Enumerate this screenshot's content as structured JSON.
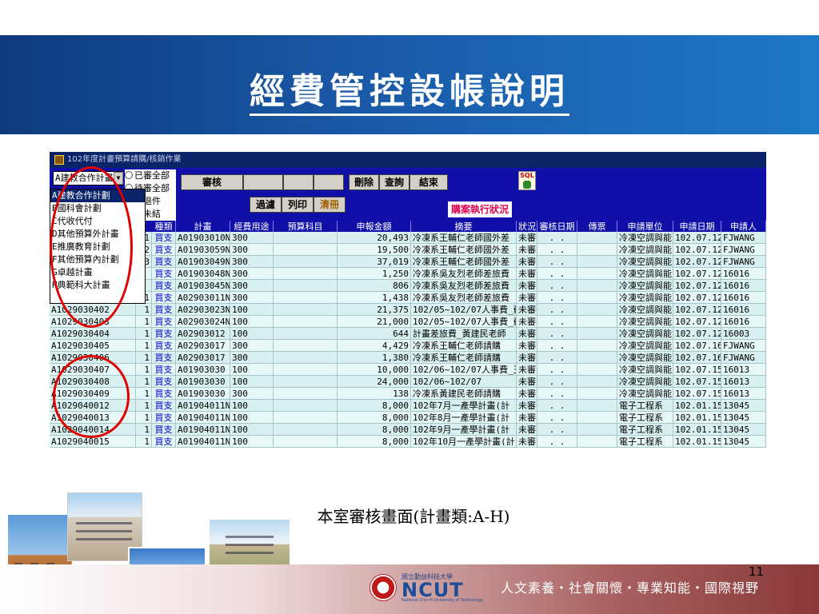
{
  "slide": {
    "title": "經費管控設帳說明",
    "caption": "本室審核畫面(計畫類:A-H)",
    "page_number": "11",
    "motto": "人文素養‧社會關懷‧專業知能‧國際視野",
    "logo": {
      "small_text": "國立勤益科技大學",
      "main_text": "NCUT",
      "sub_text": "National Chin-Yi University of Technology"
    }
  },
  "app": {
    "window_title": "102年度計畫預算請購/核銷作業",
    "plan_select_value": "A建教合作計畫",
    "radio_options": [
      "已審全部",
      "待審全部",
      "審退件",
      "審未結"
    ],
    "buttons": {
      "review": "審核",
      "delete": "刪除",
      "query": "查詢",
      "end": "結束",
      "filter": "過濾",
      "print": "列印",
      "clear": "清冊"
    },
    "sql_label": "SQL",
    "execution_status": "購案執行狀況",
    "dropdown_items": [
      "A建教合作計劃",
      "B國科會計劃",
      "C代收代付",
      "D其他預算外計畫",
      "E推廣教育計劃",
      "F其他預算內計劃",
      "G卓越計畫",
      "H典範科大計畫"
    ],
    "columns": [
      "序",
      "種類",
      "計畫",
      "經費用途",
      "預算科目",
      "申報金額",
      "摘要",
      "狀況",
      "審核日期",
      "傳票",
      "申請單位",
      "申請日期",
      "申請人"
    ],
    "rows": [
      {
        "no": "",
        "seq": "1",
        "kind": "買支",
        "plan": "A01903010N",
        "use": "300",
        "subject": "",
        "amount": "20,493",
        "summary": "冷凍系王輔仁老師國外差",
        "status": "未審",
        "review_date": ". .",
        "voucher": "",
        "unit": "冷凍空調與能",
        "apply_date": "102.07.12",
        "applicant": "FJWANG"
      },
      {
        "no": "",
        "seq": "2",
        "kind": "買支",
        "plan": "A01903059N",
        "use": "300",
        "subject": "",
        "amount": "19,500",
        "summary": "冷凍系王輔仁老師國外差",
        "status": "未審",
        "review_date": ". .",
        "voucher": "",
        "unit": "冷凍空調與能",
        "apply_date": "102.07.12",
        "applicant": "FJWANG"
      },
      {
        "no": "",
        "seq": "3",
        "kind": "買支",
        "plan": "A01903049N",
        "use": "300",
        "subject": "",
        "amount": "37,019",
        "summary": "冷凍系王輔仁老師國外差",
        "status": "未審",
        "review_date": ". .",
        "voucher": "",
        "unit": "冷凍空調與能",
        "apply_date": "102.07.12",
        "applicant": "FJWANG"
      },
      {
        "no": "",
        "seq": "",
        "kind": "買支",
        "plan": "A01903048N",
        "use": "300",
        "subject": "",
        "amount": "1,250",
        "summary": "冷凍系吳友烈老師差旅費",
        "status": "未審",
        "review_date": ". .",
        "voucher": "",
        "unit": "冷凍空調與能",
        "apply_date": "102.07.12",
        "applicant": "16016"
      },
      {
        "no": "",
        "seq": "",
        "kind": "買支",
        "plan": "A01903045N",
        "use": "300",
        "subject": "",
        "amount": "806",
        "summary": "冷凍系吳友烈老師差旅費",
        "status": "未審",
        "review_date": ". .",
        "voucher": "",
        "unit": "冷凍空調與能",
        "apply_date": "102.07.12",
        "applicant": "16016"
      },
      {
        "no": "A1029030401",
        "seq": "1",
        "kind": "買支",
        "plan": "A02903011N",
        "use": "300",
        "subject": "",
        "amount": "1,438",
        "summary": "冷凍系吳友烈老師差旅費",
        "status": "未審",
        "review_date": ". .",
        "voucher": "",
        "unit": "冷凍空調與能",
        "apply_date": "102.07.12",
        "applicant": "16016"
      },
      {
        "no": "A1029030402",
        "seq": "1",
        "kind": "買支",
        "plan": "A02903023N",
        "use": "100",
        "subject": "",
        "amount": "21,375",
        "summary": "102/05~102/07人事費_蘇",
        "status": "未審",
        "review_date": ". .",
        "voucher": "",
        "unit": "冷凍空調與能",
        "apply_date": "102.07.12",
        "applicant": "16016"
      },
      {
        "no": "A1029030403",
        "seq": "1",
        "kind": "買支",
        "plan": "A02903024N",
        "use": "100",
        "subject": "",
        "amount": "21,000",
        "summary": "102/05~102/07人事費_蘇",
        "status": "未審",
        "review_date": ". .",
        "voucher": "",
        "unit": "冷凍空調與能",
        "apply_date": "102.07.12",
        "applicant": "16016"
      },
      {
        "no": "A1029030404",
        "seq": "1",
        "kind": "買支",
        "plan": "A02903012",
        "use": "100",
        "subject": "",
        "amount": "644",
        "summary": "計畫差旅費_黃建民老師",
        "status": "未審",
        "review_date": ". .",
        "voucher": "",
        "unit": "冷凍空調與能",
        "apply_date": "102.07.12",
        "applicant": "16003"
      },
      {
        "no": "A1029030405",
        "seq": "1",
        "kind": "買支",
        "plan": "A02903017",
        "use": "300",
        "subject": "",
        "amount": "4,429",
        "summary": "冷凍系王輔仁老師請購",
        "status": "未審",
        "review_date": ". .",
        "voucher": "",
        "unit": "冷凍空調與能",
        "apply_date": "102.07.16",
        "applicant": "FJWANG"
      },
      {
        "no": "A1029030406",
        "seq": "1",
        "kind": "買支",
        "plan": "A02903017",
        "use": "300",
        "subject": "",
        "amount": "1,380",
        "summary": "冷凍系王輔仁老師請購",
        "status": "未審",
        "review_date": ". .",
        "voucher": "",
        "unit": "冷凍空調與能",
        "apply_date": "102.07.16",
        "applicant": "FJWANG"
      },
      {
        "no": "A1029030407",
        "seq": "1",
        "kind": "買支",
        "plan": "A01903030",
        "use": "100",
        "subject": "",
        "amount": "10,000",
        "summary": "102/06~102/07人事費_王",
        "status": "未審",
        "review_date": ". .",
        "voucher": "",
        "unit": "冷凍空調與能",
        "apply_date": "102.07.15",
        "applicant": "16013"
      },
      {
        "no": "A1029030408",
        "seq": "1",
        "kind": "買支",
        "plan": "A01903030",
        "use": "100",
        "subject": "",
        "amount": "24,000",
        "summary": "102/06~102/07",
        "status": "未審",
        "review_date": ". .",
        "voucher": "",
        "unit": "冷凍空調與能",
        "apply_date": "102.07.15",
        "applicant": "16013"
      },
      {
        "no": "A1029030409",
        "seq": "1",
        "kind": "買支",
        "plan": "A01903030",
        "use": "300",
        "subject": "",
        "amount": "138",
        "summary": "冷凍系黃建民老師請購",
        "status": "未審",
        "review_date": ". .",
        "voucher": "",
        "unit": "冷凍空調與能",
        "apply_date": "102.07.15",
        "applicant": "16013"
      },
      {
        "no": "A1029040012",
        "seq": "1",
        "kind": "買支",
        "plan": "A01904011N",
        "use": "100",
        "subject": "",
        "amount": "8,000",
        "summary": "102年7月一產學計畫(計",
        "status": "未審",
        "review_date": ". .",
        "voucher": "",
        "unit": "電子工程系",
        "apply_date": "102.01.15",
        "applicant": "13045"
      },
      {
        "no": "A1029040013",
        "seq": "1",
        "kind": "買支",
        "plan": "A01904011N",
        "use": "100",
        "subject": "",
        "amount": "8,000",
        "summary": "102年8月一產學計畫(計",
        "status": "未審",
        "review_date": ". .",
        "voucher": "",
        "unit": "電子工程系",
        "apply_date": "102.01.15",
        "applicant": "13045"
      },
      {
        "no": "A1029040014",
        "seq": "1",
        "kind": "買支",
        "plan": "A01904011N",
        "use": "100",
        "subject": "",
        "amount": "8,000",
        "summary": "102年9月一產學計畫(計",
        "status": "未審",
        "review_date": ". .",
        "voucher": "",
        "unit": "電子工程系",
        "apply_date": "102.01.15",
        "applicant": "13045"
      },
      {
        "no": "A1029040015",
        "seq": "1",
        "kind": "買支",
        "plan": "A01904011N",
        "use": "100",
        "subject": "",
        "amount": "8,000",
        "summary": "102年10月一產學計畫(計",
        "status": "未審",
        "review_date": ". .",
        "voucher": "",
        "unit": "電子工程系",
        "apply_date": "102.01.15",
        "applicant": "13045"
      }
    ]
  },
  "colors": {
    "header_band": "#1a5aa8",
    "app_chrome": "#1010a8",
    "row_fill": "#d8f0f0",
    "highlight_ellipse": "#e00000",
    "kind_text": "#0000d0"
  }
}
